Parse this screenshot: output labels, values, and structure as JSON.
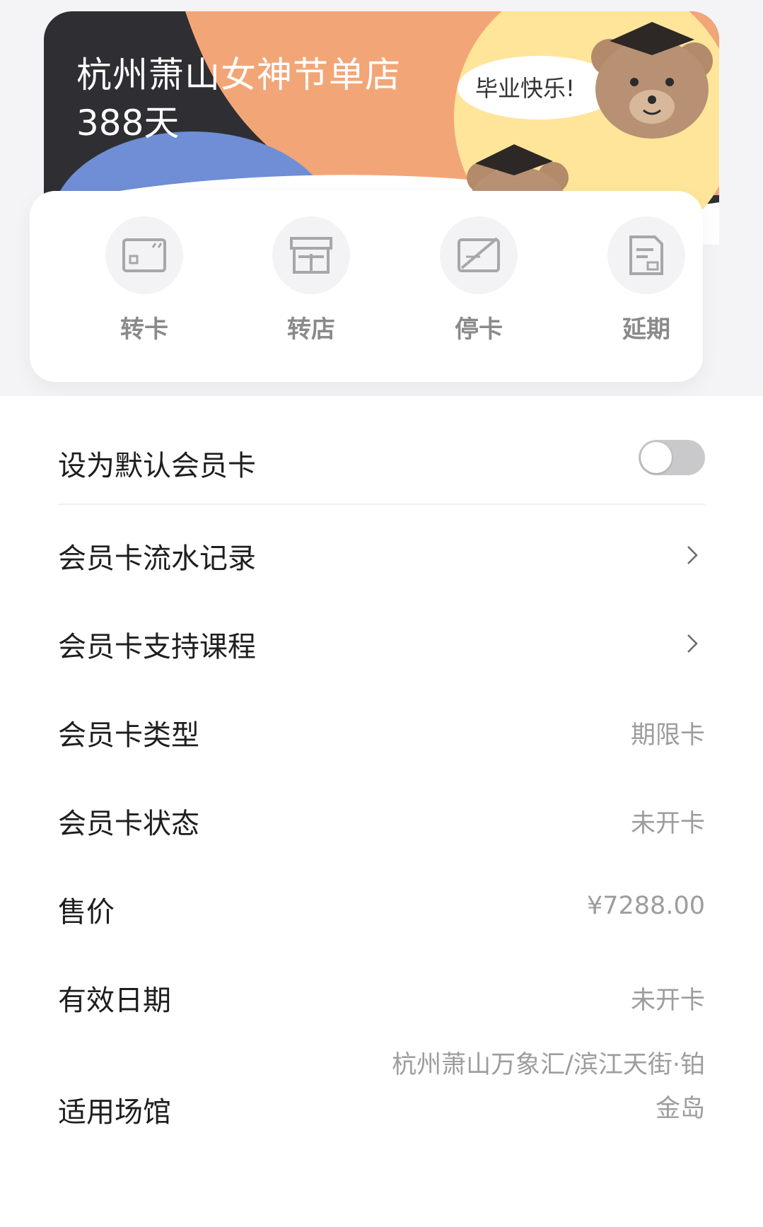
{
  "card": {
    "title": "杭州萧山女神节单店",
    "days": "388天",
    "sticker_text": "毕业快乐!",
    "colors": {
      "dark": "#2f2f33",
      "orange": "#f2a677",
      "blue": "#6f8ed6",
      "yellow": "#ffe59a",
      "bear": "#b38a6a"
    }
  },
  "actions": [
    {
      "label": "转卡",
      "icon": "transfer-card-icon"
    },
    {
      "label": "转店",
      "icon": "transfer-store-icon"
    },
    {
      "label": "停卡",
      "icon": "suspend-card-icon"
    },
    {
      "label": "延期",
      "icon": "extend-icon"
    }
  ],
  "settings": {
    "default_card_label": "设为默认会员卡",
    "default_card_enabled": false
  },
  "links": [
    {
      "label": "会员卡流水记录"
    },
    {
      "label": "会员卡支持课程"
    }
  ],
  "info": {
    "type_label": "会员卡类型",
    "type_value": "期限卡",
    "status_label": "会员卡状态",
    "status_value": "未开卡",
    "price_label": "售价",
    "price_value": "¥7288.00",
    "valid_label": "有效日期",
    "valid_value": "未开卡",
    "venue_label": "适用场馆",
    "venue_value_line1": "杭州萧山万象汇/滨江天街·铂",
    "venue_value_line2": "金岛"
  }
}
